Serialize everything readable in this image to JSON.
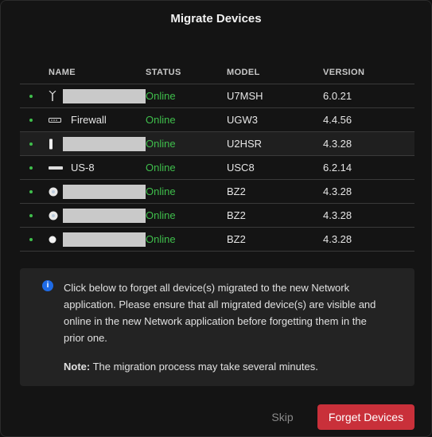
{
  "dialog": {
    "title": "Migrate Devices"
  },
  "table": {
    "headers": {
      "name": "NAME",
      "status": "STATUS",
      "model": "MODEL",
      "version": "VERSION"
    },
    "rows": [
      {
        "name": "",
        "status": "Online",
        "model": "U7MSH",
        "version": "6.0.21",
        "icon": "antenna-ap-icon"
      },
      {
        "name": "Firewall",
        "status": "Online",
        "model": "UGW3",
        "version": "4.4.56",
        "icon": "gateway-icon"
      },
      {
        "name": "",
        "status": "Online",
        "model": "U2HSR",
        "version": "4.3.28",
        "icon": "tower-ap-icon"
      },
      {
        "name": "US-8",
        "status": "Online",
        "model": "USC8",
        "version": "6.2.14",
        "icon": "switch-icon"
      },
      {
        "name": "",
        "status": "Online",
        "model": "BZ2",
        "version": "4.3.28",
        "icon": "round-ap-icon"
      },
      {
        "name": "",
        "status": "Online",
        "model": "BZ2",
        "version": "4.3.28",
        "icon": "round-ap-icon"
      },
      {
        "name": "",
        "status": "Online",
        "model": "BZ2",
        "version": "4.3.28",
        "icon": "round-ap-icon"
      }
    ]
  },
  "info": {
    "icon": "info-icon",
    "message": "Click below to forget all device(s) migrated to the new Network application. Please ensure that all migrated device(s) are visible and online in the new Network application before forgetting them in the prior one.",
    "note_label": "Note:",
    "note_text": " The migration process may take several minutes."
  },
  "actions": {
    "skip_label": "Skip",
    "forget_label": "Forget Devices"
  },
  "colors": {
    "online": "#3fbf4c",
    "primary_button": "#c9303a",
    "info_icon": "#1e6be6"
  }
}
